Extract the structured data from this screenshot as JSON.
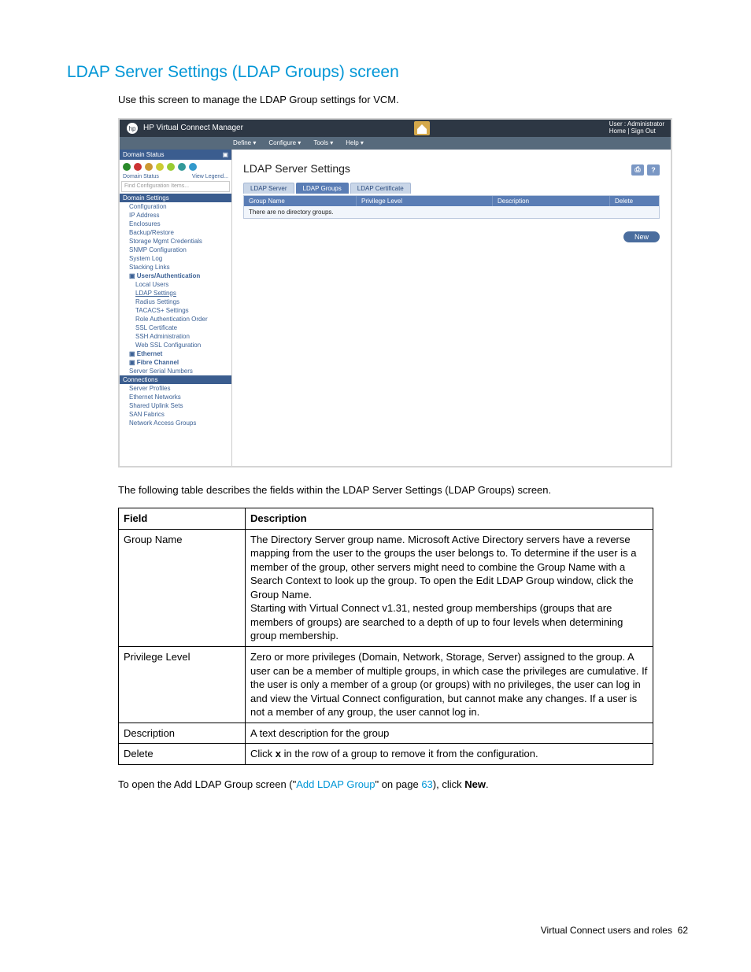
{
  "heading": "LDAP Server Settings (LDAP Groups) screen",
  "intro": "Use this screen to manage the LDAP Group settings for VCM.",
  "screenshot": {
    "product": "HP Virtual Connect Manager",
    "user_label": "User : Administrator",
    "home_link": "Home",
    "signout_link": "Sign Out",
    "menus": [
      "Define ▾",
      "Configure ▾",
      "Tools ▾",
      "Help ▾"
    ],
    "domain_status": "Domain Status",
    "view_legend": "View Legend...",
    "legend_left": "Domain Status",
    "search_placeholder": "Find Configuration Items...",
    "section1": "Domain Settings",
    "items1": [
      "Configuration",
      "IP Address",
      "Enclosures",
      "Backup/Restore",
      "Storage Mgmt Credentials",
      "SNMP Configuration",
      "System Log",
      "Stacking Links"
    ],
    "users_auth": "Users/Authentication",
    "items_auth": [
      "Local Users",
      "LDAP Settings",
      "Radius Settings",
      "TACACS+ Settings",
      "Role Authentication Order",
      "SSL Certificate",
      "SSH Administration",
      "Web SSL Configuration"
    ],
    "ethernet": "Ethernet",
    "fibre": "Fibre Channel",
    "item_serials": "Server Serial Numbers",
    "section2": "Connections",
    "items2": [
      "Server Profiles",
      "Ethernet Networks",
      "Shared Uplink Sets",
      "SAN Fabrics",
      "Network Access Groups"
    ],
    "main_title": "LDAP Server Settings",
    "tabs": [
      "LDAP Server",
      "LDAP Groups",
      "LDAP Certificate"
    ],
    "cols": {
      "group": "Group Name",
      "priv": "Privilege Level",
      "desc": "Description",
      "del": "Delete"
    },
    "empty": "There are no directory groups.",
    "new_btn": "New"
  },
  "caption": "The following table describes the fields within the LDAP Server Settings (LDAP Groups) screen.",
  "table": {
    "h_field": "Field",
    "h_desc": "Description",
    "rows": [
      {
        "f": "Group Name",
        "d": "The Directory Server group name. Microsoft Active Directory servers have a reverse mapping from the user to the groups the user belongs to. To determine if the user is a member of the group, other servers might need to combine the Group Name with a Search Context to look up the group. To open the Edit LDAP Group window, click the Group Name.\nStarting with Virtual Connect v1.31, nested group memberships (groups that are members of groups) are searched to a depth of up to four levels when determining group membership."
      },
      {
        "f": "Privilege Level",
        "d": "Zero or more privileges (Domain, Network, Storage, Server) assigned to the group. A user can be a member of multiple groups, in which case the privileges are cumulative. If the user is only a member of a group (or groups) with no privileges, the user can log in and view the Virtual Connect configuration, but cannot make any changes. If a user is not a member of any group, the user cannot log in."
      },
      {
        "f": "Description",
        "d": "A text description for the group"
      },
      {
        "f": "Delete",
        "d_pre": "Click ",
        "d_bold": "x",
        "d_post": " in the row of a group to remove it from the configuration."
      }
    ]
  },
  "postnote": {
    "pre": "To open the Add LDAP Group screen (\"",
    "link1": "Add LDAP Group",
    "mid": "\" on page ",
    "link2": "63",
    "post": "), click ",
    "bold": "New",
    "end": "."
  },
  "footer": {
    "text": "Virtual Connect users and roles",
    "page": "62"
  }
}
